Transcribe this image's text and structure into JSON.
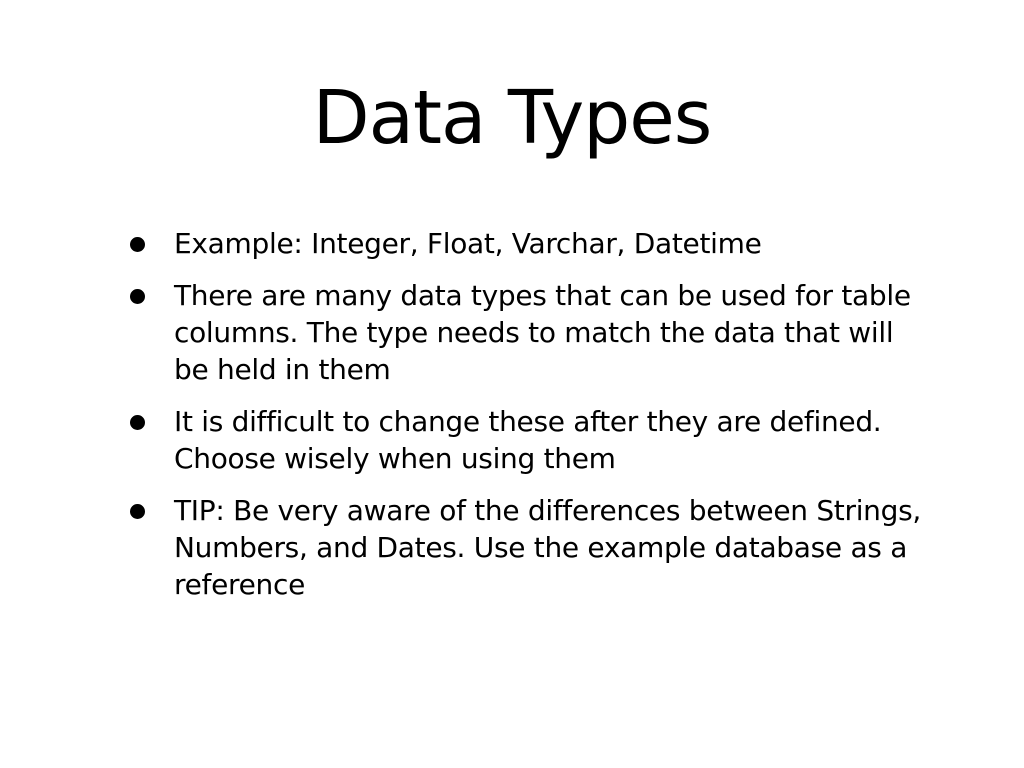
{
  "slide": {
    "title": "Data Types",
    "bullets": [
      {
        "text": "Example: Integer, Float, Varchar, Datetime"
      },
      {
        "text": "There are many data types that can be used for table columns. The type needs to match the data that will be held in them"
      },
      {
        "text": "It is difficult to change these after they are defined. Choose wisely when using them"
      },
      {
        "text": "TIP: Be very aware of the differences between Strings, Numbers, and Dates. Use the example database as a reference"
      }
    ]
  },
  "colors": {
    "background": "#ffffff",
    "text": "#000000"
  }
}
